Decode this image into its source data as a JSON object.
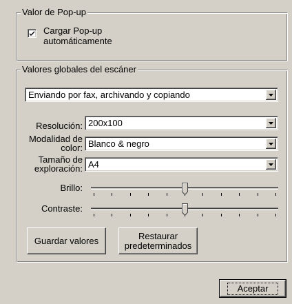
{
  "popup_group": {
    "title": "Valor de Pop-up",
    "checkbox_label_line1": "Cargar Pop-up",
    "checkbox_label_line2": "automáticamente",
    "checked": true
  },
  "scanner_group": {
    "title": "Valores globales del escáner",
    "mode_select": {
      "value": "Enviando por fax, archivando y copiando"
    },
    "resolution": {
      "label": "Resolución:",
      "value": "200x100"
    },
    "color_mode": {
      "label_line1": "Modalidad de",
      "label_line2": "color:",
      "value": "Blanco & negro"
    },
    "scan_size": {
      "label_line1": "Tamaño de",
      "label_line2": "exploración:",
      "value": "A4"
    },
    "brightness": {
      "label": "Brillo:",
      "level_fraction": 0.5
    },
    "contrast": {
      "label": "Contraste:",
      "level_fraction": 0.5
    },
    "save_button": "Guardar valores",
    "restore_button_line1": "Restaurar",
    "restore_button_line2": "predeterminados"
  },
  "accept_button": "Aceptar"
}
